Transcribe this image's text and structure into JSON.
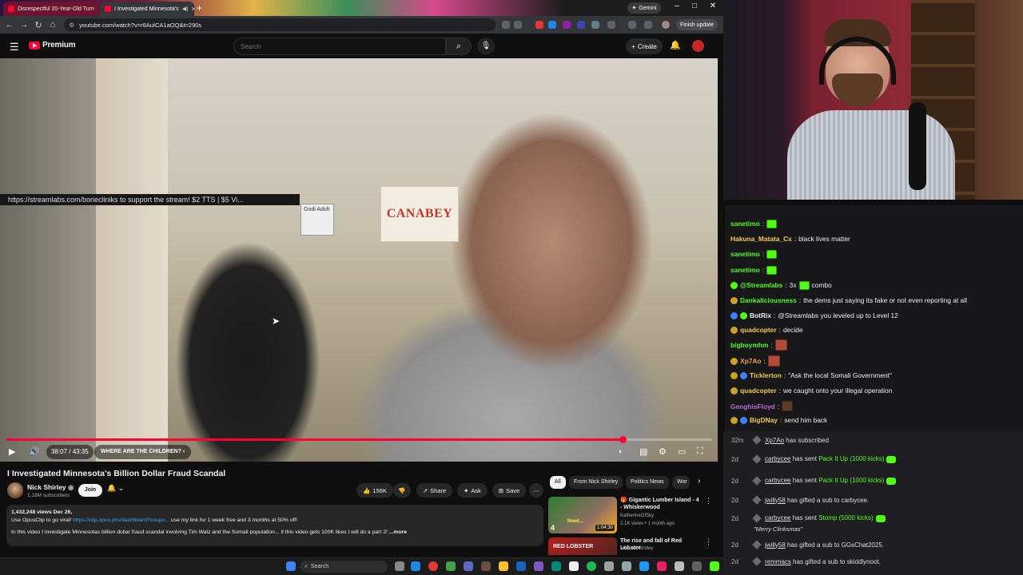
{
  "browser": {
    "tabs": [
      {
        "title": "Disrespectful 20-Year-Old Turn",
        "active": false
      },
      {
        "title": "I Investigated Minnesota's",
        "active": true
      }
    ],
    "gemini_label": "Gemini",
    "url": "youtube.com/watch?v=r8AuICA1aOQ&t=290s",
    "finish_update_label": "Finish update"
  },
  "youtube": {
    "logo_text": "Premium",
    "search_placeholder": "Search",
    "create_label": "Create",
    "player": {
      "current_time": "38:07 / 43:35",
      "chapter": "WHERE ARE THE CHILDREN?",
      "progress_fraction": 0.874,
      "scene_banner_text": "CANABEY",
      "scene_sign_text": "Godi Adult"
    },
    "video": {
      "title": "I Investigated Minnesota's Billion Dollar Fraud Scandal",
      "channel": "Nick Shirley",
      "subscribers": "1.18M subscribers",
      "join_label": "Join",
      "likes": "156K",
      "share_label": "Share",
      "ask_label": "Ask",
      "save_label": "Save",
      "description": {
        "meta": "1,432,248 views  Dec 26,",
        "line1_prefix": "Use OpusClip to go viral!",
        "line1_link": "https://clip.opus.pro/dashboard?coupo...",
        "line1_suffix": " use my link for 1 week free and 3 months at 50% off!",
        "line2": "In this video I investigate Minnesotas billion dollar fraud scandal involving Tim Walz and the Somali population... if this video gets 100K likes I will do a part 2!",
        "more_label": "...more"
      }
    },
    "chips": [
      "All",
      "From Nick Shirley",
      "Politics News",
      "Wor"
    ],
    "recommendations": [
      {
        "title": "🎁 Gigantic Lumber Island - 4 - Whiskerwood",
        "channel": "KatherineOfSky",
        "meta": "2.1K views • 1 month ago",
        "duration": "1:04:30",
        "badge": "4",
        "thumb_text": "Need..."
      },
      {
        "title": "The rise and fall of Red Lobster",
        "channel": "Michael Girdley",
        "meta": "",
        "duration": "",
        "thumb_text": "RED LOBSTER"
      }
    ]
  },
  "taskbar": {
    "search_label": "Search"
  },
  "stream": {
    "pinned": "https://streamlabs.com/boriecliniks to support the stream! $2 TTS | $5 Vi...",
    "chat": [
      {
        "user": "sanetimo",
        "color": "#53fc18",
        "text": "",
        "emotes": [
          "green"
        ]
      },
      {
        "user": "Hakuna_Matata_Cx",
        "color": "#f2c94c",
        "text": "black lives matter",
        "emotes": []
      },
      {
        "user": "sanetimo",
        "color": "#53fc18",
        "text": "",
        "emotes": [
          "green"
        ]
      },
      {
        "user": "sanetimo",
        "color": "#53fc18",
        "text": "",
        "emotes": [
          "green"
        ]
      },
      {
        "user": "@Streamlabs",
        "color": "#53fc18",
        "text": "3x",
        "suffix": "combo",
        "emotes": [
          "green"
        ],
        "badges": [
          "#53fc18"
        ]
      },
      {
        "user": "Dankaliciousness",
        "color": "#53fc18",
        "text": "the dems just saying its fake or not even reporting at all",
        "emotes": [],
        "badges": [
          "#c9a227"
        ]
      },
      {
        "user": "BotRix",
        "color": "#f1f1f1",
        "text": "@Streamlabs you leveled up to Level 12",
        "emotes": [],
        "badges": [
          "#3b82f6",
          "#53fc18"
        ]
      },
      {
        "user": "quadcopter",
        "color": "#f2c94c",
        "text": "decide",
        "emotes": [],
        "badges": [
          "#c9a227"
        ]
      },
      {
        "user": "bigboymhm",
        "color": "#53fc18",
        "text": "",
        "emotes": [
          "red"
        ]
      },
      {
        "user": "Xp7Ao",
        "color": "#f2994a",
        "text": "",
        "emotes": [
          "red"
        ],
        "badges": [
          "#c9a227"
        ]
      },
      {
        "user": "Ticklerton",
        "color": "#f2c94c",
        "text": "\"Ask the local Somali Government\"",
        "emotes": [],
        "badges": [
          "#c9a227",
          "#3b82f6"
        ]
      },
      {
        "user": "quadcopter",
        "color": "#f2c94c",
        "text": "we caught onto your illegal operation",
        "emotes": [],
        "badges": [
          "#c9a227"
        ]
      },
      {
        "user": "GenghisFloyd",
        "color": "#bb6bd9",
        "text": "",
        "emotes": [
          "brown"
        ]
      },
      {
        "user": "BigDNay",
        "color": "#f2c94c",
        "text": "send him back",
        "emotes": [],
        "badges": [
          "#c9a227",
          "#3b82f6"
        ]
      }
    ],
    "events": [
      {
        "ago": "32m",
        "name": "Xp7Ao",
        "text": "has subscribed",
        "gift": "",
        "kick": false
      },
      {
        "ago": "2d",
        "name": "carbycee",
        "text": "has sent",
        "gift": "Pack It Up (1000 kicks)",
        "kick": true
      },
      {
        "ago": "2d",
        "name": "carbycee",
        "text": "has sent",
        "gift": "Pack It Up (1000 kicks)",
        "kick": true
      },
      {
        "ago": "2d",
        "name": "jwilly58",
        "text": "has gifted a sub to carbycee.",
        "gift": "",
        "kick": false
      },
      {
        "ago": "2d",
        "name": "carbycee",
        "text": "has sent",
        "gift": "Stomp (5000 kicks)",
        "kick": true,
        "sub": "\"Merry Clinksmas\""
      },
      {
        "ago": "2d",
        "name": "jwilly58",
        "text": "has gifted a sub to GGsChat2025.",
        "gift": "",
        "kick": false
      },
      {
        "ago": "2d",
        "name": "remmacs",
        "text": "has gifted a sub to skiddlynoot.",
        "gift": "",
        "kick": false
      }
    ]
  }
}
